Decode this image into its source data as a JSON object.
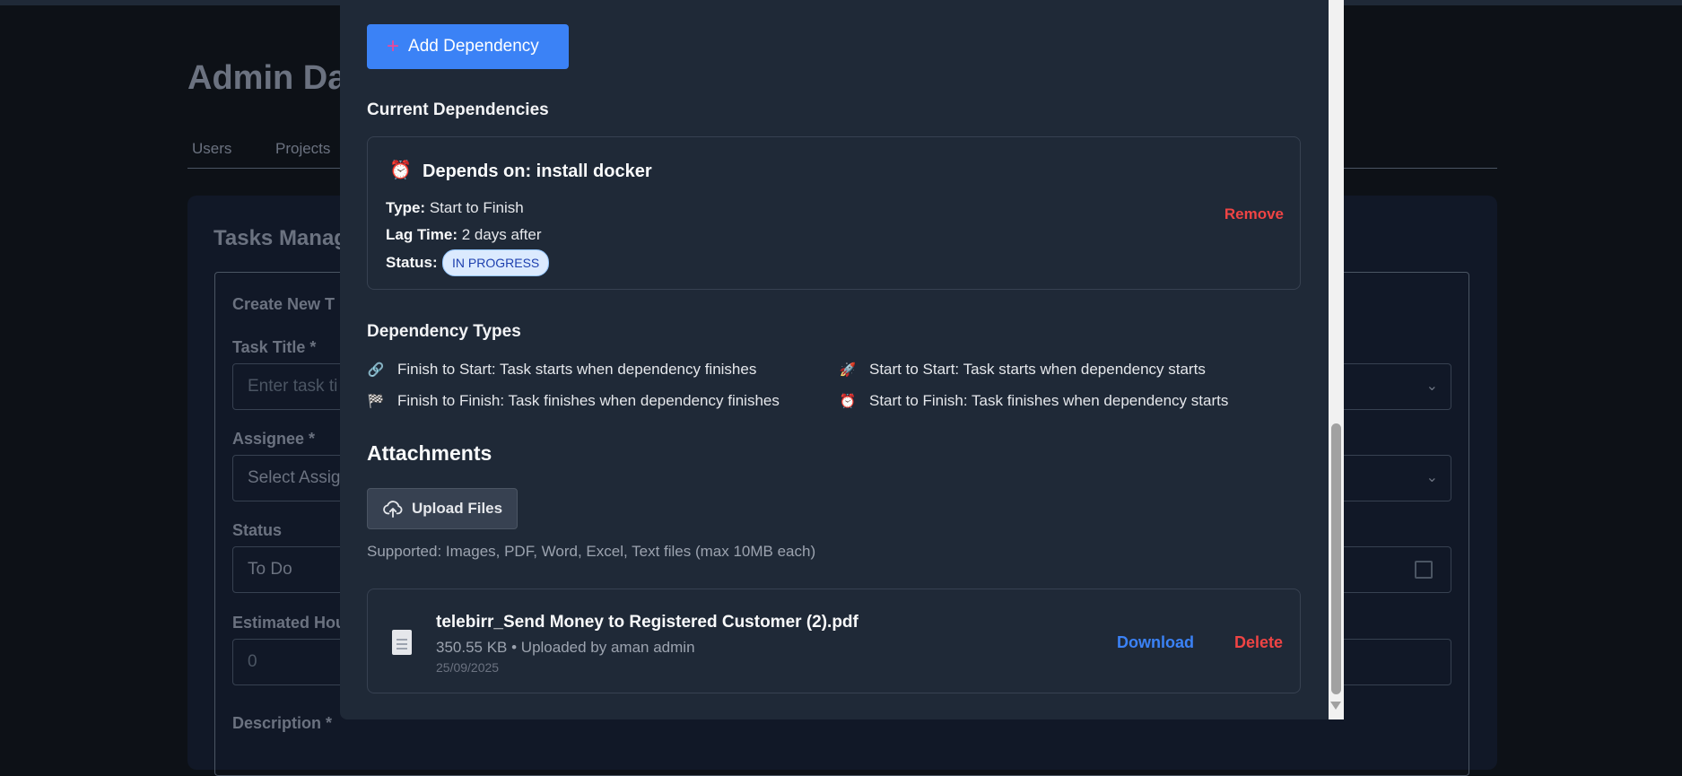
{
  "background": {
    "page_title": "Admin Da",
    "nav_tabs": [
      "Users",
      "Projects"
    ],
    "card_title": "Tasks Manag",
    "form_title": "Create New T",
    "task_title_label": "Task Title *",
    "task_title_placeholder": "Enter task ti",
    "assignee_label": "Assignee *",
    "assignee_value": "Select Assig",
    "status_label": "Status",
    "status_value": "To Do",
    "hours_label": "Estimated Hour",
    "hours_placeholder": "0",
    "description_label": "Description *"
  },
  "modal": {
    "add_dependency_label": "Add Dependency",
    "current_deps_heading": "Current Dependencies",
    "dependency": {
      "title": "Depends on: install docker",
      "type_label": "Type:",
      "type_value": "Start to Finish",
      "lag_label": "Lag Time:",
      "lag_value": "2 days after",
      "status_label": "Status:",
      "status_badge": "IN PROGRESS",
      "remove_label": "Remove"
    },
    "dependency_types_heading": "Dependency Types",
    "dependency_types": [
      {
        "icon": "link-icon",
        "glyph": "🔗",
        "text": "Finish to Start: Task starts when dependency finishes"
      },
      {
        "icon": "rocket-icon",
        "glyph": "🚀",
        "text": "Start to Start: Task starts when dependency starts"
      },
      {
        "icon": "checkered-flag-icon",
        "glyph": "🏁",
        "text": "Finish to Finish: Task finishes when dependency finishes"
      },
      {
        "icon": "alarm-clock-icon",
        "glyph": "⏰",
        "text": "Start to Finish: Task finishes when dependency starts"
      }
    ],
    "attachments_heading": "Attachments",
    "upload_label": "Upload Files",
    "supported_text": "Supported: Images, PDF, Word, Excel, Text files (max 10MB each)",
    "file": {
      "name": "telebirr_Send Money to Registered Customer (2).pdf",
      "meta": "350.55 KB • Uploaded by aman admin",
      "date": "25/09/2025",
      "download_label": "Download",
      "delete_label": "Delete"
    }
  },
  "colors": {
    "accent": "#3b82f6",
    "danger": "#ef4444",
    "modal_bg": "#1f2937",
    "page_bg": "#0d1117"
  }
}
